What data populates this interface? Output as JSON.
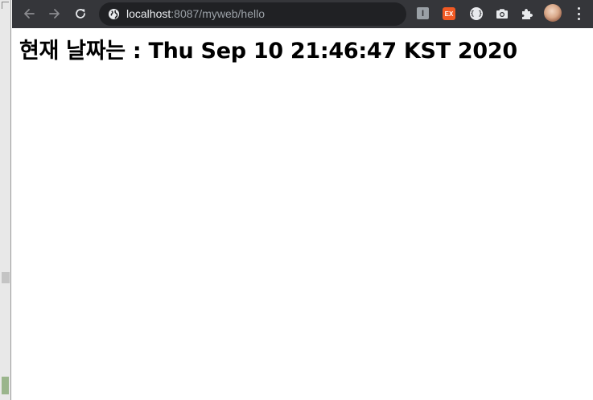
{
  "browser": {
    "url_host": "localhost",
    "url_rest": ":8087/myweb/hello",
    "icons": {
      "back": "back-arrow-icon",
      "forward": "forward-arrow-icon",
      "reload": "reload-icon",
      "site_info": "globe-icon",
      "extensions": [
        "reader-extension-icon",
        "ex-extension-icon",
        "code-extension-icon",
        "camera-extension-icon",
        "puzzle-icon"
      ],
      "profile": "avatar",
      "menu": "kebab-menu-icon"
    },
    "extension_labels": {
      "reader": "I",
      "ex": "EX",
      "code": "{ }"
    },
    "colors": {
      "toolbar": "#35363a",
      "omnibox": "#202124",
      "url_host": "#e8eaed",
      "url_rest": "#9aa0a6",
      "ex_badge": "#f15a24"
    }
  },
  "page": {
    "heading": "현재 날짜는 : Thu Sep 10 21:46:47 KST 2020"
  }
}
